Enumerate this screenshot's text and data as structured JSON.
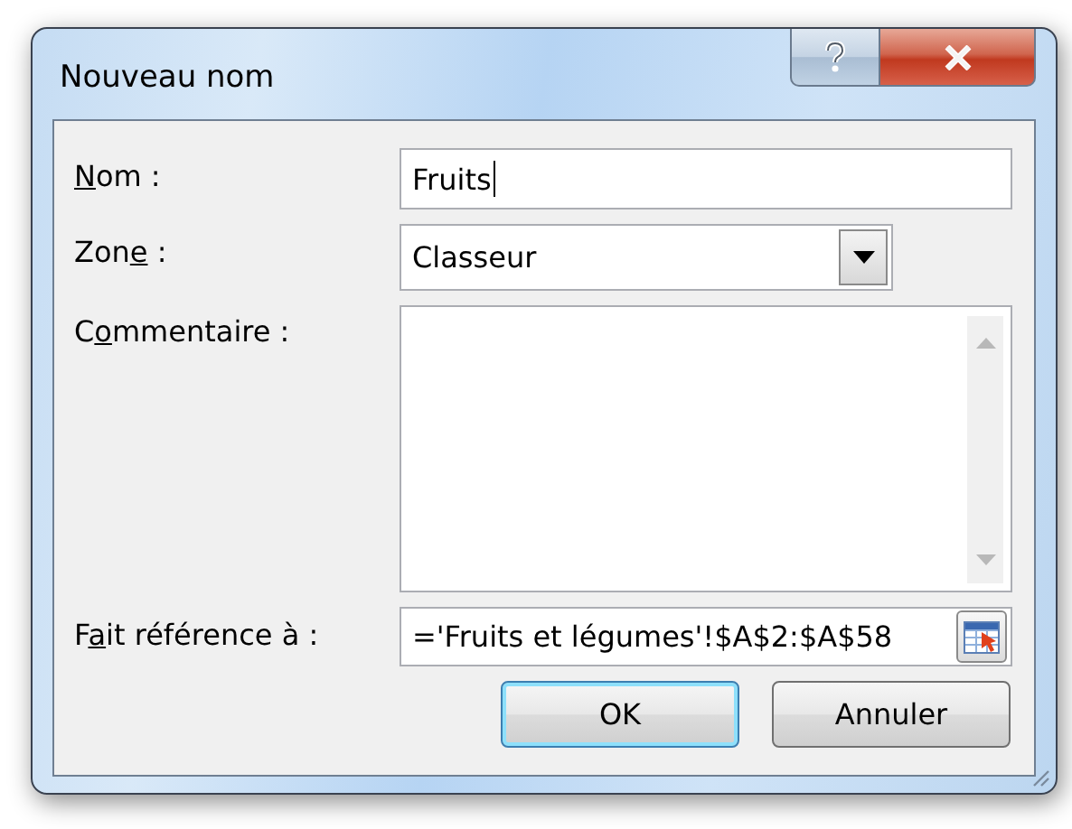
{
  "window": {
    "title": "Nouveau nom"
  },
  "title_buttons": [
    {
      "kind": "help"
    },
    {
      "kind": "close"
    }
  ],
  "fields": [
    {
      "kind": "text",
      "label": {
        "key": "N",
        "after": "om :"
      },
      "value": "Fruits",
      "focused": true
    },
    {
      "kind": "dropdown",
      "label": {
        "before": "Zon",
        "key": "e",
        "after": " :"
      },
      "value": "Classeur"
    },
    {
      "kind": "multiline",
      "label": {
        "before": "C",
        "key": "o",
        "after": "mmentaire :"
      }
    },
    {
      "kind": "reference",
      "label": {
        "before": "F",
        "key": "a",
        "after": "it référence à :"
      },
      "value": "='Fruits et légumes'!$A$2:$A$58"
    }
  ],
  "buttons": [
    {
      "label": "OK",
      "default": true
    },
    {
      "label": "Annuler",
      "default": false
    }
  ]
}
